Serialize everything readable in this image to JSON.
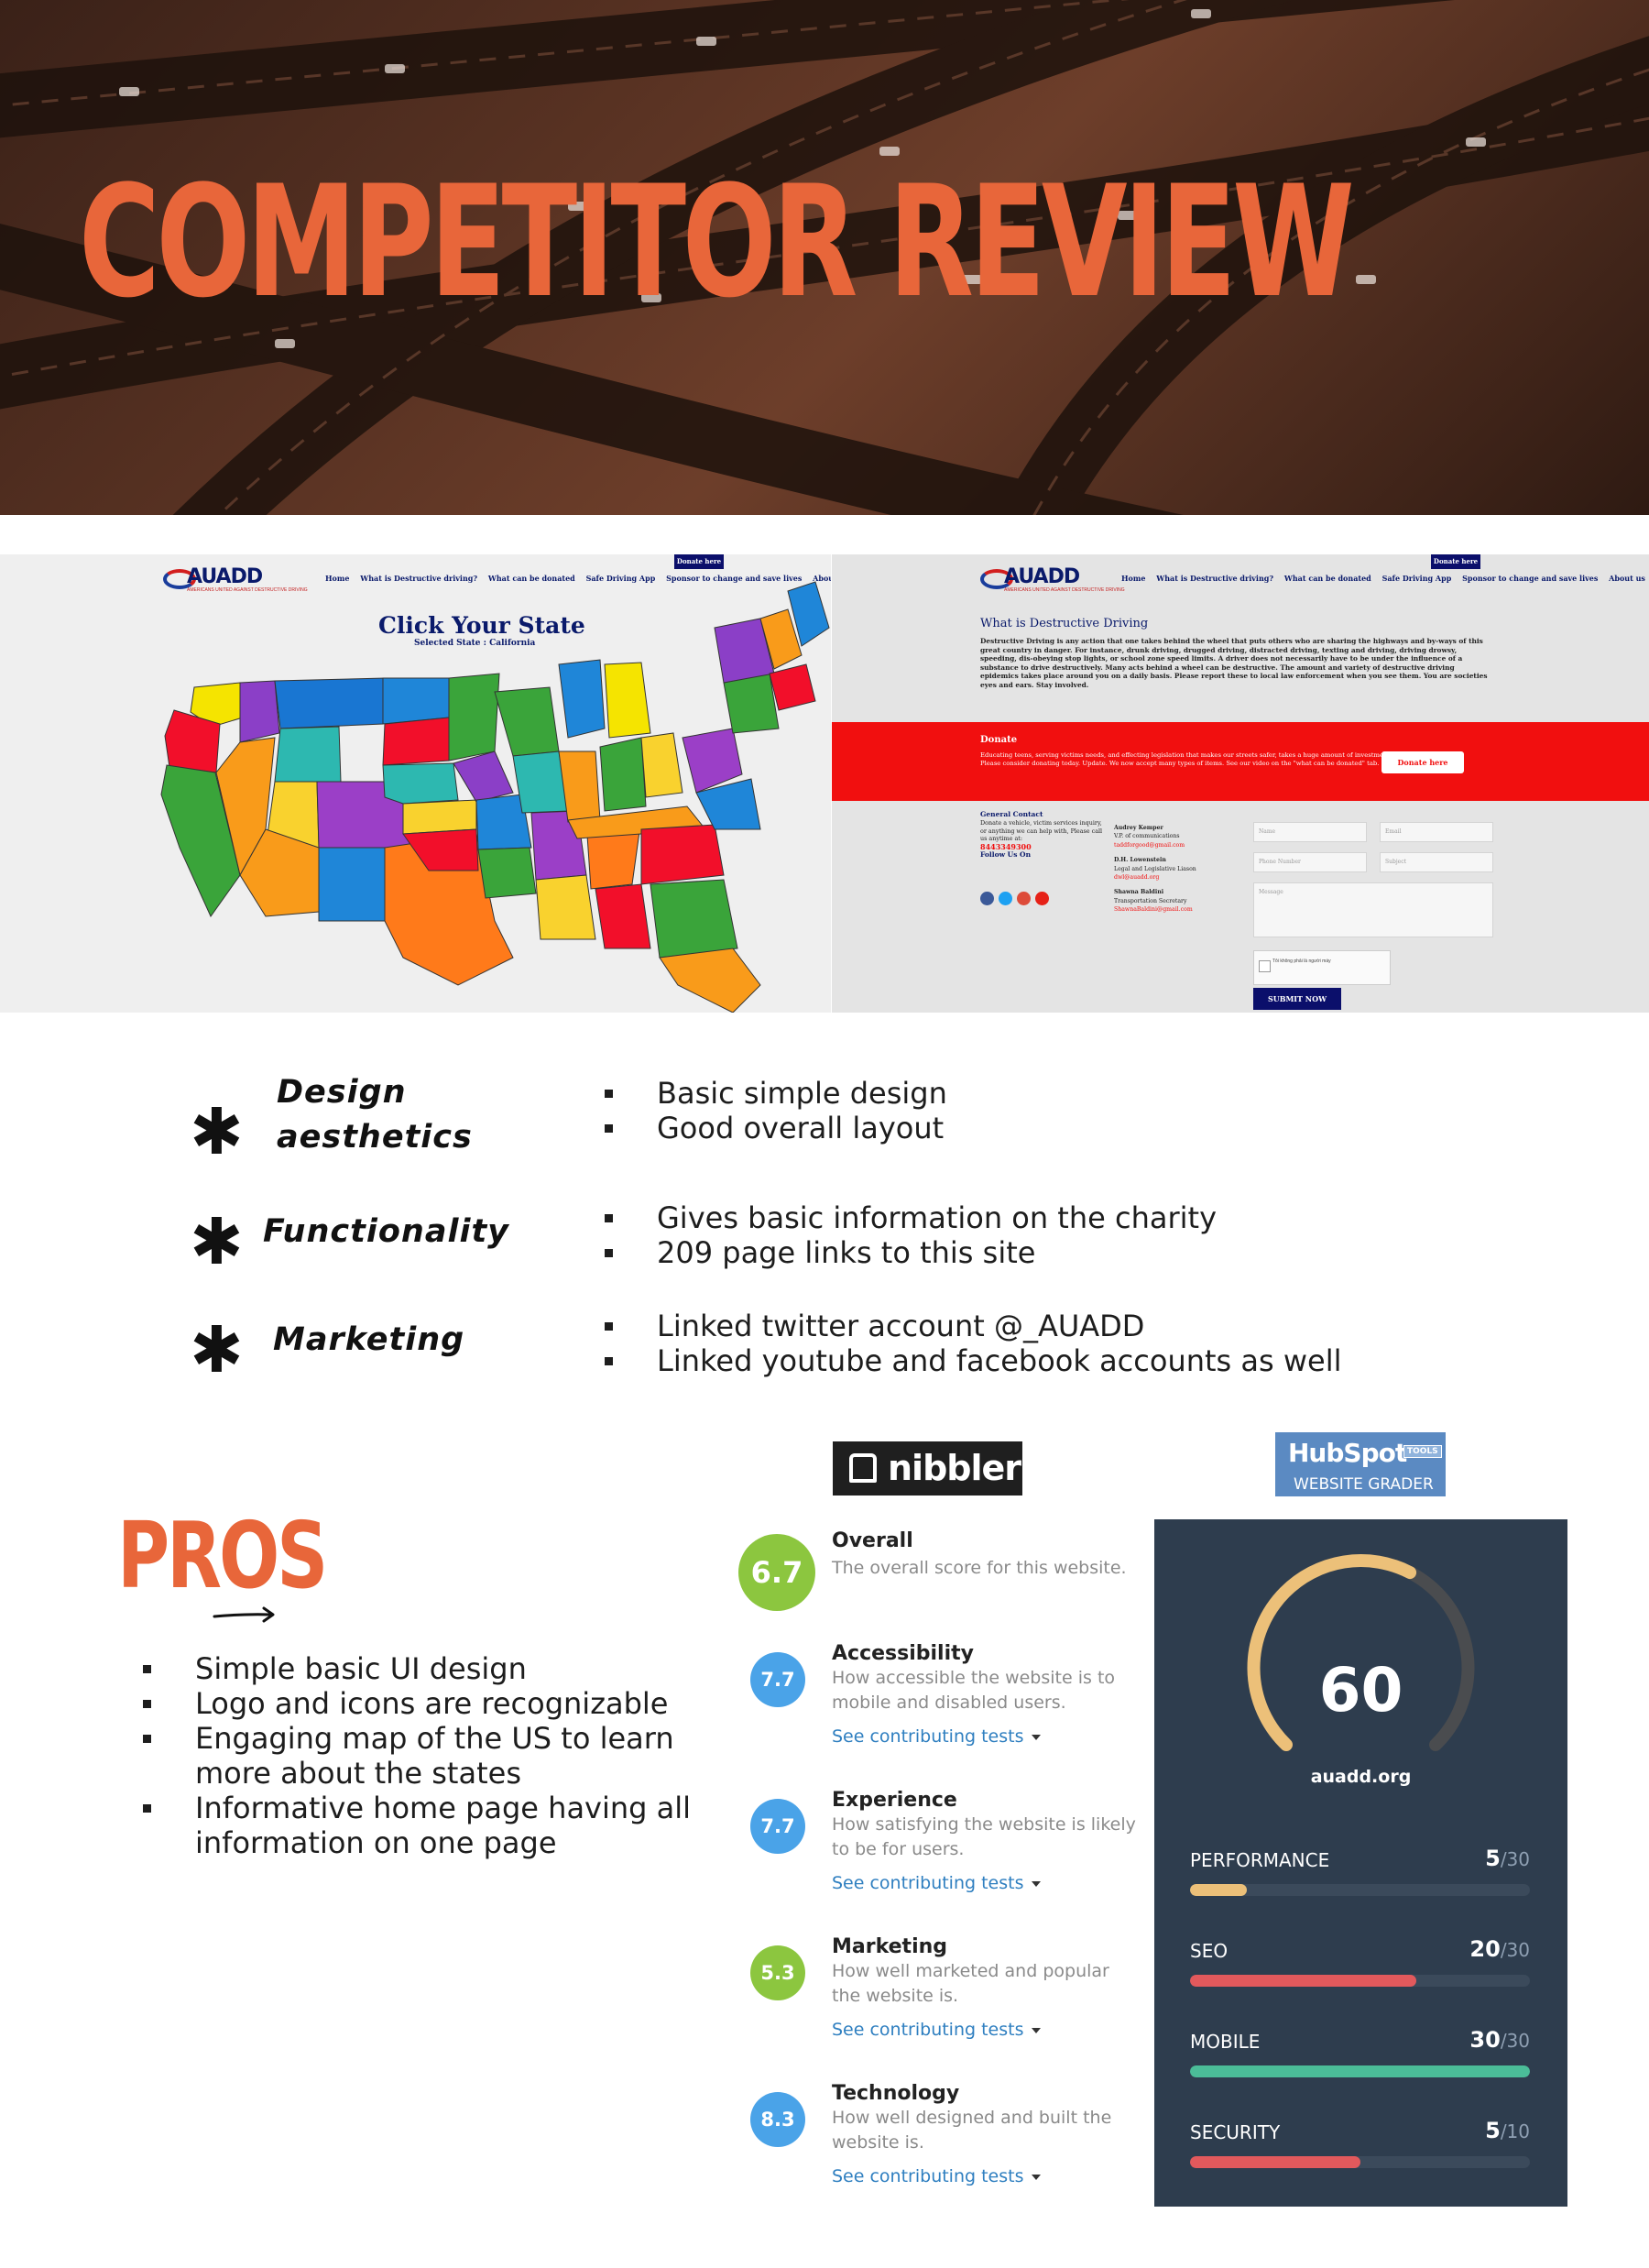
{
  "hero": {
    "title": "COMPETITOR REVIEW"
  },
  "site_home": {
    "logo": "AUADD",
    "logo_tagline": "AMERICANS UNITED AGAINST DESTRUCTIVE DRIVING",
    "donate_button": "Donate here",
    "nav": [
      "Home",
      "What is Destructive driving?",
      "What can be donated",
      "Safe Driving App",
      "Sponsor to change and save lives",
      "About us"
    ],
    "map_title": "Click Your State",
    "map_subtitle": "Selected State : California"
  },
  "site_info": {
    "logo": "AUADD",
    "logo_tagline": "AMERICANS UNITED AGAINST DESTRUCTIVE DRIVING",
    "donate_button": "Donate here",
    "nav": [
      "Home",
      "What is Destructive driving?",
      "What can be donated",
      "Safe Driving App",
      "Sponsor to change and save lives",
      "About us"
    ],
    "section_title": "What is Destructive Driving",
    "body": "Destructive Driving is any action that one takes behind the wheel that puts others who are sharing the highways and by-ways of this great country in danger. For instance, drunk driving, drugged driving, distracted driving, texting and driving, driving drowsy, speeding, dis-obeying stop lights, or school zone speed limits. A driver does not necessarily have to be under the influence of a substance to drive destructively. Many acts behind a wheel can be destructive. The amount and variety of destructive driving epidemics takes place around you on a daily basis. Please report these to local law enforcement when you see them. You are societies eyes and ears. Stay involved.",
    "donate_title": "Donate",
    "donate_body": "Educating teens, serving victims needs, and effecting legislation that makes our streets safer, takes a huge amount of investment. Please consider donating today. Update. We now accept many types of items. See our video on the \"what can be donated\" tab.",
    "donate_cta": "Donate here",
    "contact_title": "General Contact",
    "contact_body": "Donate a vehicle, victim services inquiry, or anything we can help with, Please call us anytime at:",
    "phone": "8443349300",
    "follow": "Follow Us On",
    "staff": [
      {
        "name": "Audrey Kemper",
        "role": "V.P. of communications",
        "email": "taddforgood@gmail.com"
      },
      {
        "name": "D.H. Lowenstein",
        "role": "Legal and Legislative Liason",
        "email": "dwl@auadd.org"
      },
      {
        "name": "Shawna Baldini",
        "role": "Transportation Secretary",
        "email": "ShawnaBaldini@gmail.com"
      }
    ],
    "form": {
      "name": "Name",
      "email": "Email",
      "phone": "Phone Number",
      "subject": "Subject",
      "message": "Message",
      "captcha": "Tôi không phải là người máy",
      "submit": "SUBMIT NOW"
    }
  },
  "criteria": [
    {
      "label": "Design aesthetics",
      "points": [
        "Basic simple design",
        "Good overall layout"
      ]
    },
    {
      "label": "Functionality",
      "points": [
        "Gives basic information on the charity",
        "209 page links to this site"
      ]
    },
    {
      "label": "Marketing",
      "points": [
        "Linked twitter account @_AUADD",
        "Linked youtube and facebook accounts as well"
      ]
    }
  ],
  "pros": {
    "title": "PROS",
    "items": [
      "Simple basic UI design",
      "Logo and icons are recognizable",
      "Engaging map of the US to learn more about the states",
      "Informative home page having all information on one page"
    ]
  },
  "nibbler": {
    "brand": "nibbler",
    "link_text": "See contributing tests",
    "overall": {
      "score": "6.7",
      "title": "Overall",
      "desc": "The overall score for this website.",
      "color": "#8cc63f"
    },
    "items": [
      {
        "score": "7.7",
        "title": "Accessibility",
        "desc": "How accessible the website is to mobile and disabled users.",
        "color": "#4aa3e8"
      },
      {
        "score": "7.7",
        "title": "Experience",
        "desc": "How satisfying the website is likely to be for users.",
        "color": "#4aa3e8"
      },
      {
        "score": "5.3",
        "title": "Marketing",
        "desc": "How well marketed and popular the website is.",
        "color": "#8cc63f"
      },
      {
        "score": "8.3",
        "title": "Technology",
        "desc": "How well designed and built the website is.",
        "color": "#4aa3e8"
      }
    ]
  },
  "hubspot": {
    "brand": "HubSpot",
    "tools": "TOOLS",
    "subtitle": "WEBSITE GRADER",
    "score": "60",
    "score_fraction": 0.6,
    "site": "auadd.org",
    "metrics": [
      {
        "label": "PERFORMANCE",
        "value": "5",
        "max": "/30",
        "fraction": 0.167,
        "color": "#ecc079"
      },
      {
        "label": "SEO",
        "value": "20",
        "max": "/30",
        "fraction": 0.667,
        "color": "#e2595c"
      },
      {
        "label": "MOBILE",
        "value": "30",
        "max": "/30",
        "fraction": 1.0,
        "color": "#4bbd98"
      },
      {
        "label": "SECURITY",
        "value": "5",
        "max": "/10",
        "fraction": 0.5,
        "color": "#e2595c"
      }
    ]
  }
}
